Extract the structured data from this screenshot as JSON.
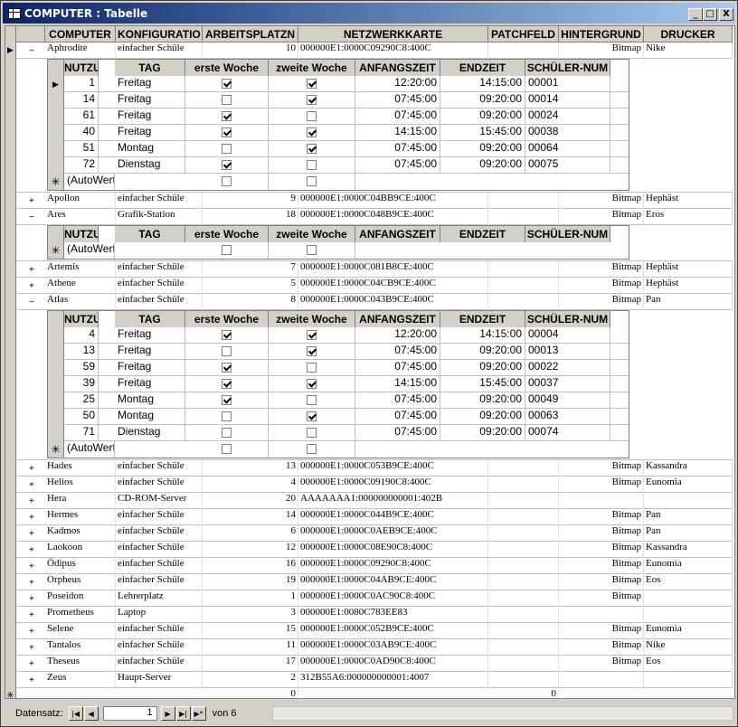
{
  "window": {
    "title": "COMPUTER : Tabelle",
    "min": "_",
    "max": "□",
    "close": "X"
  },
  "headers": [
    "COMPUTER",
    "KONFIGURATIO",
    "ARBEITSPLATZN",
    "NETZWERKKARTE",
    "PATCHFELD",
    "HINTERGRUND",
    "DRUCKER"
  ],
  "sub_headers": [
    "NUTZUNG",
    "TAG",
    "erste Woche",
    "zweite Woche",
    "ANFANGSZEIT",
    "ENDZEIT",
    "SCHÜLER-NUM"
  ],
  "new_row_placeholder": "(AutoWert)",
  "rows": [
    {
      "name": "Aphrodite",
      "konfig": "einfacher Schüle",
      "platz": "10",
      "netz": "000000E1:0000C09290C8:400C",
      "patch": "",
      "hint": "Bitmap",
      "druck": "Nike",
      "expanded": true,
      "sub": [
        [
          "1",
          "Freitag",
          true,
          true,
          "12:20:00",
          "14:15:00",
          "00001"
        ],
        [
          "14",
          "Freitag",
          false,
          true,
          "07:45:00",
          "09:20:00",
          "00014"
        ],
        [
          "61",
          "Freitag",
          true,
          false,
          "07:45:00",
          "09:20:00",
          "00024"
        ],
        [
          "40",
          "Freitag",
          true,
          true,
          "14:15:00",
          "15:45:00",
          "00038"
        ],
        [
          "51",
          "Montag",
          false,
          true,
          "07:45:00",
          "09:20:00",
          "00064"
        ],
        [
          "72",
          "Dienstag",
          true,
          false,
          "07:45:00",
          "09:20:00",
          "00075"
        ]
      ]
    },
    {
      "name": "Apollon",
      "konfig": "einfacher Schüle",
      "platz": "9",
      "netz": "000000E1:0000C04BB9CE:400C",
      "patch": "",
      "hint": "Bitmap",
      "druck": "Hephäst",
      "expanded": false
    },
    {
      "name": "Ares",
      "konfig": "Grafik-Station",
      "platz": "18",
      "netz": "000000E1:0000C048B9CE:400C",
      "patch": "",
      "hint": "Bitmap",
      "druck": "Eros",
      "expanded": true,
      "sub": []
    },
    {
      "name": "Artemis",
      "konfig": "einfacher Schüle",
      "platz": "7",
      "netz": "000000E1:0000C081B8CE:400C",
      "patch": "",
      "hint": "Bitmap",
      "druck": "Hephäst",
      "expanded": false
    },
    {
      "name": "Athene",
      "konfig": "einfacher Schüle",
      "platz": "5",
      "netz": "000000E1:0000C04CB9CE:400C",
      "patch": "",
      "hint": "Bitmap",
      "druck": "Hephäst",
      "expanded": false
    },
    {
      "name": "Atlas",
      "konfig": "einfacher Schüle",
      "platz": "8",
      "netz": "000000E1:0000C043B9CE:400C",
      "patch": "",
      "hint": "Bitmap",
      "druck": "Pan",
      "expanded": true,
      "sub": [
        [
          "4",
          "Freitag",
          true,
          true,
          "12:20:00",
          "14:15:00",
          "00004"
        ],
        [
          "13",
          "Freitag",
          false,
          true,
          "07:45:00",
          "09:20:00",
          "00013"
        ],
        [
          "59",
          "Freitag",
          true,
          false,
          "07:45:00",
          "09:20:00",
          "00022"
        ],
        [
          "39",
          "Freitag",
          true,
          true,
          "14:15:00",
          "15:45:00",
          "00037"
        ],
        [
          "25",
          "Montag",
          true,
          false,
          "07:45:00",
          "09:20:00",
          "00049"
        ],
        [
          "50",
          "Montag",
          false,
          true,
          "07:45:00",
          "09:20:00",
          "00063"
        ],
        [
          "71",
          "Dienstag",
          false,
          false,
          "07:45:00",
          "09:20:00",
          "00074"
        ]
      ]
    },
    {
      "name": "Hades",
      "konfig": "einfacher Schüle",
      "platz": "13",
      "netz": "000000E1:0000C053B9CE:400C",
      "patch": "",
      "hint": "Bitmap",
      "druck": "Kassandra",
      "expanded": false
    },
    {
      "name": "Helios",
      "konfig": "einfacher Schüle",
      "platz": "4",
      "netz": "000000E1:0000C09190C8:400C",
      "patch": "",
      "hint": "Bitmap",
      "druck": "Eunomia",
      "expanded": false
    },
    {
      "name": "Hera",
      "konfig": "CD-ROM-Server",
      "platz": "20",
      "netz": "AAAAAAA1:000000000001:402B",
      "patch": "",
      "hint": "",
      "druck": "",
      "expanded": false
    },
    {
      "name": "Hermes",
      "konfig": "einfacher Schüle",
      "platz": "14",
      "netz": "000000E1:0000C044B9CE:400C",
      "patch": "",
      "hint": "Bitmap",
      "druck": "Pan",
      "expanded": false
    },
    {
      "name": "Kadmos",
      "konfig": "einfacher Schüle",
      "platz": "6",
      "netz": "000000E1:0000C0AEB9CE:400C",
      "patch": "",
      "hint": "Bitmap",
      "druck": "Pan",
      "expanded": false
    },
    {
      "name": "Laokoon",
      "konfig": "einfacher Schüle",
      "platz": "12",
      "netz": "000000E1:0000C08E90C8:400C",
      "patch": "",
      "hint": "Bitmap",
      "druck": "Kassandra",
      "expanded": false
    },
    {
      "name": "Ödipus",
      "konfig": "einfacher Schüle",
      "platz": "16",
      "netz": "000000E1:0000C09290C8:400C",
      "patch": "",
      "hint": "Bitmap",
      "druck": "Eunomia",
      "expanded": false
    },
    {
      "name": "Orpheus",
      "konfig": "einfacher Schüle",
      "platz": "19",
      "netz": "000000E1:0000C04AB9CE:400C",
      "patch": "",
      "hint": "Bitmap",
      "druck": "Eos",
      "expanded": false
    },
    {
      "name": "Poseidon",
      "konfig": "Lehrerplatz",
      "platz": "1",
      "netz": "000000E1:0000C0AC90C8:400C",
      "patch": "",
      "hint": "Bitmap",
      "druck": "",
      "expanded": false
    },
    {
      "name": "Prometheus",
      "konfig": "Laptop",
      "platz": "3",
      "netz": "000000E1:0080C783EE83",
      "patch": "",
      "hint": "",
      "druck": "",
      "expanded": false
    },
    {
      "name": "Selene",
      "konfig": "einfacher Schüle",
      "platz": "15",
      "netz": "000000E1:0000C052B9CE:400C",
      "patch": "",
      "hint": "Bitmap",
      "druck": "Eunomia",
      "expanded": false
    },
    {
      "name": "Tantalos",
      "konfig": "einfacher Schüle",
      "platz": "11",
      "netz": "000000E1:0000C03AB9CE:400C",
      "patch": "",
      "hint": "Bitmap",
      "druck": "Nike",
      "expanded": false
    },
    {
      "name": "Theseus",
      "konfig": "einfacher Schüle",
      "platz": "17",
      "netz": "000000E1:0000C0AD90C8:400C",
      "patch": "",
      "hint": "Bitmap",
      "druck": "Eos",
      "expanded": false
    },
    {
      "name": "Zeus",
      "konfig": "Haupt-Server",
      "platz": "2",
      "netz": "312B55A6:000000000001:4007",
      "patch": "",
      "hint": "",
      "druck": "",
      "expanded": false
    }
  ],
  "new_row": {
    "platz": "0",
    "patch": "0"
  },
  "status": {
    "label": "Datensatz:",
    "record": "1",
    "of_label": "von 6",
    "nav_first": "|◀",
    "nav_prev": "◀",
    "nav_next": "▶",
    "nav_last": "▶|",
    "nav_new": "▶*"
  }
}
